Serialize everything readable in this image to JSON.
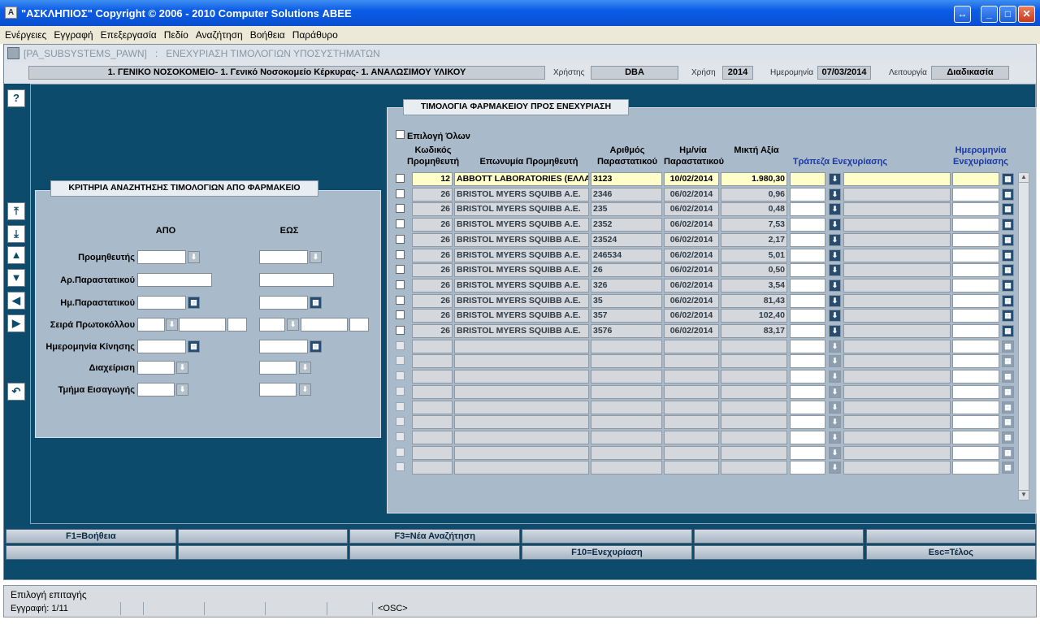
{
  "window": {
    "title": "\"ΑΣΚΛΗΠΙΟΣ\" Copyright © 2006 - 2010 Computer Solutions ΑΒΕΕ",
    "icon": "app-icon"
  },
  "menu": [
    "Ενέργειες",
    "Εγγραφή",
    "Επεξεργασία",
    "Πεδίο",
    "Αναζήτηση",
    "Βοήθεια",
    "Παράθυρο"
  ],
  "subheader": {
    "form_id": "[PA_SUBSYSTEMS_PAWN]",
    "sep": ":",
    "form_title": "ΕΝΕΧΥΡΙΑΣΗ ΤΙΜΟΛΟΓΙΩΝ ΥΠΟΣΥΣΤΗΜΑΤΩΝ"
  },
  "info": {
    "unit": "1. ΓΕΝΙΚΟ ΝΟΣΟΚΟΜΕΙΟ- 1. Γενικό Νοσοκομείο Κέρκυρας- 1. ΑΝΑΛΩΣΙΜΟΥ ΥΛΙΚΟΥ",
    "user_label": "Χρήστης",
    "user": "DBA",
    "year_label": "Χρήση",
    "year": "2014",
    "date_label": "Ημερομηνία",
    "date": "07/03/2014",
    "mode_label": "Λειτουργία",
    "mode": "Διαδικασία"
  },
  "criteria": {
    "title": "ΚΡΙΤΗΡΙΑ ΑΝΑΖΗΤΗΣΗΣ ΤΙΜΟΛΟΓΙΩΝ ΑΠΟ ΦΑΡΜΑΚΕΙΟ",
    "from_label": "ΑΠΟ",
    "to_label": "ΕΩΣ",
    "fields": [
      "Προμηθευτής",
      "Αρ.Παραστατικού",
      "Ημ.Παραστατικού",
      "Σειρά Πρωτοκόλλου",
      "Ημερομηνία Κίνησης",
      "Διαχείριση",
      "Τμήμα Εισαγωγής"
    ]
  },
  "invoices": {
    "title": "ΤΙΜΟΛΟΓΙΑ ΦΑΡΜΑΚΕΙΟΥ ΠΡΟΣ ΕΝΕΧΥΡΙΑΣΗ",
    "select_all": "Επιλογή Όλων",
    "headers": {
      "supplier_code": "Κωδικός Προμηθευτή",
      "supplier_name": "Επωνυμία Προμηθευτή",
      "doc_no": "Αριθμός Παραστατικού",
      "doc_date": "Ημ/νία Παραστατικού",
      "gross": "Μικτή Αξία",
      "bank": "Τράπεζα Ενεχυρίασης",
      "pawn_date": "Ημερομηνία Ενεχυρίασης"
    },
    "rows": [
      {
        "code": "12",
        "name": "ABBOTT LABORATORIES (ΕΛΛΑΣ)",
        "doc": "3123",
        "date": "10/02/2014",
        "value": "1.980,30"
      },
      {
        "code": "26",
        "name": "BRISTOL MYERS SQUIBB A.E.",
        "doc": "2346",
        "date": "06/02/2014",
        "value": "0,96"
      },
      {
        "code": "26",
        "name": "BRISTOL MYERS SQUIBB A.E.",
        "doc": "235",
        "date": "06/02/2014",
        "value": "0,48"
      },
      {
        "code": "26",
        "name": "BRISTOL MYERS SQUIBB A.E.",
        "doc": "2352",
        "date": "06/02/2014",
        "value": "7,53"
      },
      {
        "code": "26",
        "name": "BRISTOL MYERS SQUIBB A.E.",
        "doc": "23524",
        "date": "06/02/2014",
        "value": "2,17"
      },
      {
        "code": "26",
        "name": "BRISTOL MYERS SQUIBB A.E.",
        "doc": "246534",
        "date": "06/02/2014",
        "value": "5,01"
      },
      {
        "code": "26",
        "name": "BRISTOL MYERS SQUIBB A.E.",
        "doc": "26",
        "date": "06/02/2014",
        "value": "0,50"
      },
      {
        "code": "26",
        "name": "BRISTOL MYERS SQUIBB A.E.",
        "doc": "326",
        "date": "06/02/2014",
        "value": "3,54"
      },
      {
        "code": "26",
        "name": "BRISTOL MYERS SQUIBB A.E.",
        "doc": "35",
        "date": "06/02/2014",
        "value": "81,43"
      },
      {
        "code": "26",
        "name": "BRISTOL MYERS SQUIBB A.E.",
        "doc": "357",
        "date": "06/02/2014",
        "value": "102,40"
      },
      {
        "code": "26",
        "name": "BRISTOL MYERS SQUIBB A.E.",
        "doc": "3576",
        "date": "06/02/2014",
        "value": "83,17"
      }
    ],
    "empty_rows": 9
  },
  "fkeys": [
    "F1=Βοήθεια",
    "",
    "F3=Νέα Αναζήτηση",
    "",
    "",
    "",
    "",
    "",
    "",
    "F10=Ενεχυρίαση",
    "",
    "Esc=Τέλος"
  ],
  "status": {
    "line1": "Επιλογή επιταγής",
    "record": "Εγγραφή: 1/11",
    "osc": "<OSC>"
  }
}
